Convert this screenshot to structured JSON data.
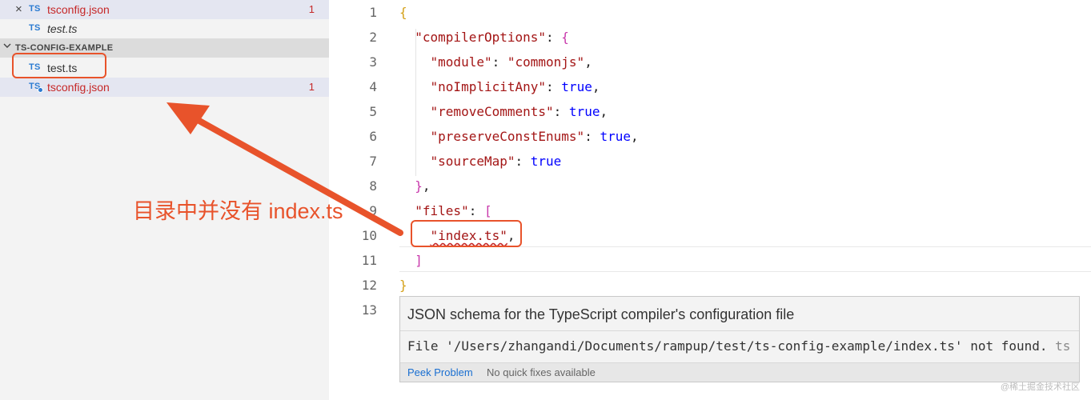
{
  "sidebar": {
    "open_editors": [
      {
        "close_glyph": "×",
        "icon": "TS",
        "name": "tsconfig.json",
        "count": "1"
      },
      {
        "icon": "TS",
        "name": "test.ts"
      }
    ],
    "folder": {
      "chevron": "⌵",
      "name": "TS-CONFIG-EXAMPLE"
    },
    "files": [
      {
        "icon": "TS",
        "name": "test.ts"
      },
      {
        "icon": "TS",
        "name": "tsconfig.json",
        "count": "1"
      }
    ]
  },
  "editor": {
    "line_numbers": [
      "1",
      "2",
      "3",
      "4",
      "5",
      "6",
      "7",
      "8",
      "9",
      "10",
      "11",
      "12",
      "13"
    ],
    "lines": [
      {
        "tokens": [
          {
            "t": "{",
            "c": "brace1"
          }
        ]
      },
      {
        "tokens": [
          {
            "t": "  "
          },
          {
            "t": "\"compilerOptions\"",
            "c": "keyname"
          },
          {
            "t": ": "
          },
          {
            "t": "{",
            "c": "brace2"
          }
        ]
      },
      {
        "tokens": [
          {
            "t": "    "
          },
          {
            "t": "\"module\"",
            "c": "keyname"
          },
          {
            "t": ": "
          },
          {
            "t": "\"commonjs\"",
            "c": "str"
          },
          {
            "t": ","
          }
        ]
      },
      {
        "tokens": [
          {
            "t": "    "
          },
          {
            "t": "\"noImplicitAny\"",
            "c": "keyname"
          },
          {
            "t": ": "
          },
          {
            "t": "true",
            "c": "bool"
          },
          {
            "t": ","
          }
        ]
      },
      {
        "tokens": [
          {
            "t": "    "
          },
          {
            "t": "\"removeComments\"",
            "c": "keyname"
          },
          {
            "t": ": "
          },
          {
            "t": "true",
            "c": "bool"
          },
          {
            "t": ","
          }
        ]
      },
      {
        "tokens": [
          {
            "t": "    "
          },
          {
            "t": "\"preserveConstEnums\"",
            "c": "keyname"
          },
          {
            "t": ": "
          },
          {
            "t": "true",
            "c": "bool"
          },
          {
            "t": ","
          }
        ]
      },
      {
        "tokens": [
          {
            "t": "    "
          },
          {
            "t": "\"sourceMap\"",
            "c": "keyname"
          },
          {
            "t": ": "
          },
          {
            "t": "true",
            "c": "bool"
          }
        ]
      },
      {
        "tokens": [
          {
            "t": "  "
          },
          {
            "t": "}",
            "c": "brace2"
          },
          {
            "t": ","
          }
        ]
      },
      {
        "tokens": [
          {
            "t": "  "
          },
          {
            "t": "\"files\"",
            "c": "keyname"
          },
          {
            "t": ": "
          },
          {
            "t": "[",
            "c": "brack"
          }
        ]
      },
      {
        "tokens": [
          {
            "t": "    "
          },
          {
            "t": "\"index.ts\"",
            "c": "str"
          },
          {
            "t": ","
          }
        ]
      },
      {
        "tokens": [
          {
            "t": "  "
          },
          {
            "t": "]",
            "c": "brack"
          }
        ]
      },
      {
        "tokens": [
          {
            "t": "}",
            "c": "brace1"
          }
        ]
      },
      {
        "tokens": []
      }
    ]
  },
  "hover": {
    "title": "JSON schema for the TypeScript compiler's configuration file",
    "message": "File '/Users/zhangandi/Documents/rampup/test/ts-config-example/index.ts' not found.",
    "source": "ts",
    "peek_label": "Peek Problem",
    "no_fix_label": "No quick fixes available"
  },
  "annotation": {
    "text": "目录中并没有 index.ts",
    "color": "#e8532b"
  },
  "watermark": "@稀土掘金技术社区",
  "colors": {
    "sidebar_bg": "#f3f3f3",
    "selected_row": "#e4e6f1",
    "error_red": "#c62828",
    "ts_blue": "#2b7bd2"
  }
}
